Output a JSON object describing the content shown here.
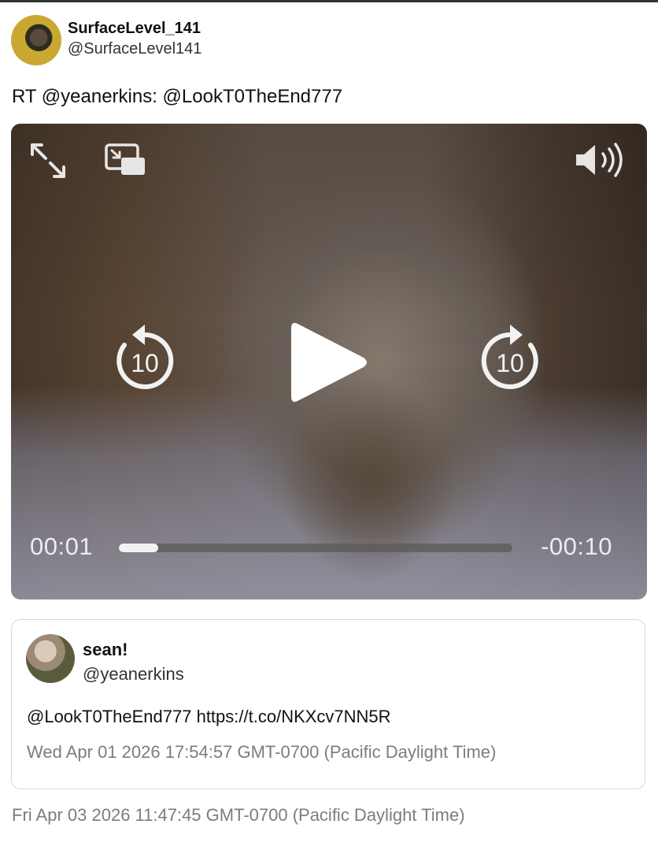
{
  "author": {
    "display_name": "SurfaceLevel_141",
    "handle": "@SurfaceLevel141"
  },
  "tweet": {
    "text": "RT @yeanerkins: @LookT0TheEnd777",
    "timestamp": "Fri Apr 03 2026 11:47:45 GMT-0700 (Pacific Daylight Time)"
  },
  "video": {
    "elapsed": "00:01",
    "remaining": "-00:10",
    "progress_fraction": 0.1,
    "skip_back_seconds": "10",
    "skip_forward_seconds": "10",
    "icons": [
      "fullscreen-icon",
      "picture-in-picture-icon",
      "volume-icon",
      "skip-back-10-icon",
      "play-icon",
      "skip-forward-10-icon"
    ]
  },
  "quoted": {
    "display_name": "sean!",
    "handle": "@yeanerkins",
    "text": "@LookT0TheEnd777 https://t.co/NKXcv7NN5R",
    "timestamp": "Wed Apr 01 2026 17:54:57 GMT-0700 (Pacific Daylight Time)"
  }
}
